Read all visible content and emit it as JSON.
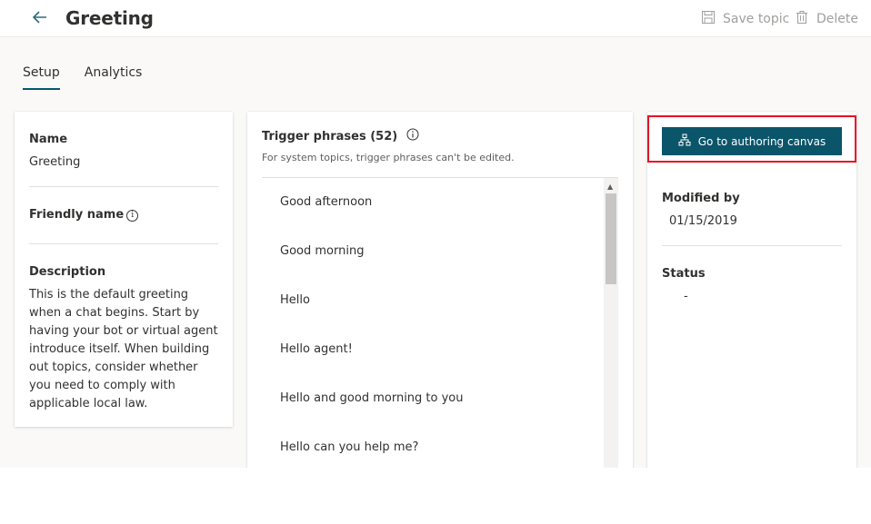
{
  "header": {
    "title": "Greeting",
    "save_label": "Save topic",
    "delete_label": "Delete"
  },
  "tabs": [
    {
      "label": "Setup",
      "active": true
    },
    {
      "label": "Analytics",
      "active": false
    }
  ],
  "details": {
    "name_label": "Name",
    "name_value": "Greeting",
    "friendly_label": "Friendly name",
    "description_label": "Description",
    "description_value": "This is the default greeting when a chat begins. Start by having your bot or virtual agent introduce itself. When building out topics, consider whether you need to comply with applicable local law."
  },
  "trigger": {
    "title": "Trigger phrases (52)",
    "subtitle": "For system topics, trigger phrases can't be edited.",
    "phrases": [
      "Good afternoon",
      "Good morning",
      "Hello",
      "Hello agent!",
      "Hello and good morning to you",
      "Hello can you help me?"
    ]
  },
  "side": {
    "canvas_button": "Go to authoring canvas",
    "modified_label": "Modified by",
    "modified_value": "01/15/2019",
    "status_label": "Status",
    "status_value": "-"
  },
  "colors": {
    "accent": "#0b556a",
    "tab_underline": "#005a70",
    "highlight_box": "#e81123"
  }
}
